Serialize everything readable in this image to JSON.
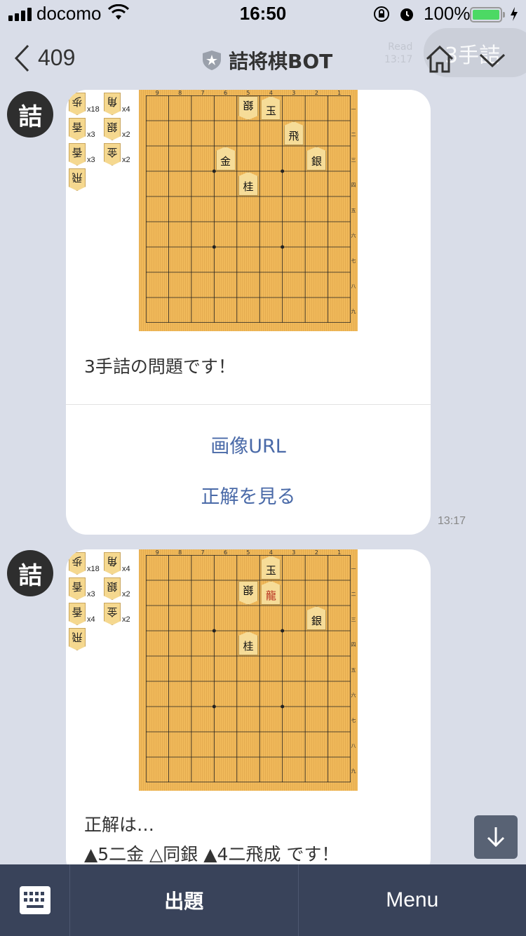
{
  "status_bar": {
    "carrier": "docomo",
    "time": "16:50",
    "battery_percent": "100%",
    "battery_level": 1.0
  },
  "nav": {
    "back_count": "409",
    "title": "詰将棋BOT",
    "ghost_bubble_text": "3手詰",
    "ghost_read_label": "Read",
    "ghost_read_time": "13:17"
  },
  "messages": [
    {
      "avatar": "詰",
      "text": "3手詰の問題です！",
      "actions": [
        "画像URL",
        "正解を見る"
      ],
      "time": "13:17",
      "hand": [
        {
          "piece": "歩",
          "count": "x18"
        },
        {
          "piece": "香",
          "count": "x3"
        },
        {
          "piece": "香",
          "count": "x3"
        },
        {
          "piece": "飛",
          "count": ""
        },
        {
          "piece": "角",
          "count": "x4"
        },
        {
          "piece": "銀",
          "count": "x2"
        },
        {
          "piece": "金",
          "count": "x2"
        }
      ],
      "pieces": [
        {
          "label": "銀",
          "col": 5,
          "row": 1,
          "gote": true
        },
        {
          "label": "玉",
          "col": 4,
          "row": 1,
          "gote": false
        },
        {
          "label": "飛",
          "col": 3,
          "row": 2,
          "gote": false
        },
        {
          "label": "金",
          "col": 6,
          "row": 3,
          "gote": false
        },
        {
          "label": "銀",
          "col": 2,
          "row": 3,
          "gote": false
        },
        {
          "label": "桂",
          "col": 5,
          "row": 4,
          "gote": false
        }
      ]
    },
    {
      "avatar": "詰",
      "text_line1": "正解は…",
      "text_line2": "▲5二金 △同銀 ▲4二飛成 です！",
      "hand": [
        {
          "piece": "歩",
          "count": "x18"
        },
        {
          "piece": "香",
          "count": "x3"
        },
        {
          "piece": "香",
          "count": "x4"
        },
        {
          "piece": "飛",
          "count": ""
        },
        {
          "piece": "角",
          "count": "x4"
        },
        {
          "piece": "銀",
          "count": "x2"
        },
        {
          "piece": "金",
          "count": "x2"
        }
      ],
      "pieces": [
        {
          "label": "玉",
          "col": 4,
          "row": 1,
          "gote": false
        },
        {
          "label": "銀",
          "col": 5,
          "row": 2,
          "gote": true
        },
        {
          "label": "龍",
          "col": 4,
          "row": 2,
          "gote": false,
          "promoted": true
        },
        {
          "label": "銀",
          "col": 2,
          "row": 3,
          "gote": false
        },
        {
          "label": "桂",
          "col": 5,
          "row": 4,
          "gote": false
        }
      ]
    }
  ],
  "board_labels": {
    "columns": [
      "9",
      "8",
      "7",
      "6",
      "5",
      "4",
      "3",
      "2",
      "1"
    ],
    "rows": [
      "一",
      "二",
      "三",
      "四",
      "五",
      "六",
      "七",
      "八",
      "九"
    ]
  },
  "bottom_bar": {
    "quiz_label": "出題",
    "menu_label": "Menu"
  },
  "colors": {
    "background": "#d9dde8",
    "link": "#4a6aa8",
    "bottom_bar": "#39435a",
    "board": "#f0b95a"
  }
}
